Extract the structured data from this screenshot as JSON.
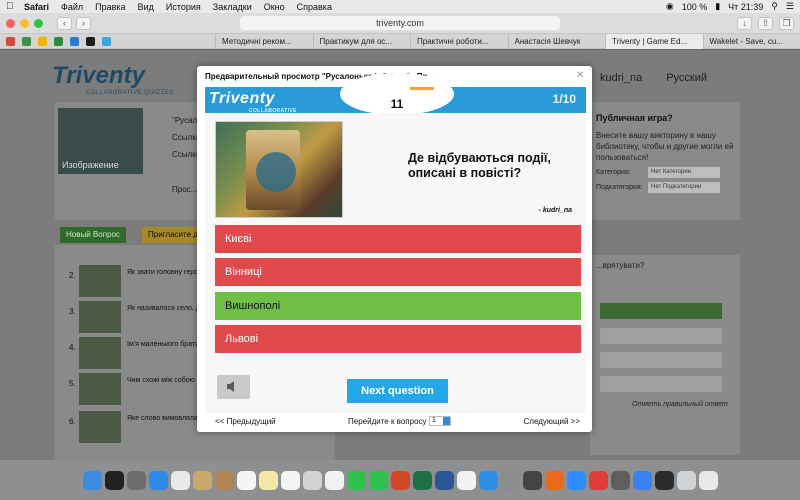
{
  "menubar": {
    "app": "Safari",
    "items": [
      "Файл",
      "Правка",
      "Вид",
      "История",
      "Закладки",
      "Окно",
      "Справка"
    ],
    "battery": "100 %",
    "clock": "Чт 21:39"
  },
  "toolbar": {
    "url": "triventy.com"
  },
  "tabs": [
    "Методичні реком...",
    "Практикум для ос...",
    "Практичні роботи...",
    "Анастасія Шевчук",
    "Triventy | Game Ed...",
    "Wakelet - Save, cu..."
  ],
  "page": {
    "logo": "Triventy",
    "logo_tagline": "COLLABORATIVE QUIZZES",
    "user": "kudri_na",
    "language": "Русский",
    "quiz_name_partial": "\"Русалонь...",
    "link_label_1": "Ссылка в...",
    "link_label_2": "Ссылка в...",
    "image_label": "Изображение",
    "preview_partial": "Прос...",
    "public_title": "Публичная игра?",
    "public_text": "Внесите вашу викторину в нашу библиотеку, чтобы и другие могли ей пользоваться!",
    "category_label": "Категория:",
    "category_value": "Нет Категории",
    "subcategory_label": "Подкатегория:",
    "subcategory_value": "Нет Подкатегории",
    "new_question_btn": "Новый Вопрос",
    "invite_btn": "Пригласите д...",
    "right_hint": "...врятувати?",
    "mark_correct": "Отметь правильный ответ",
    "list": [
      {
        "num": "2.",
        "q": "Як звати головну герої..."
      },
      {
        "num": "3.",
        "q": "Як називалося село, д... Софійки?"
      },
      {
        "num": "4.",
        "q": "Ім'я маленького брати..."
      },
      {
        "num": "5.",
        "q": "Чим схожі між собою б..."
      },
      {
        "num": "6.",
        "q": "Яке слово вимовляла ... потрапити у минуле?"
      }
    ]
  },
  "modal": {
    "title": "Предварительный просмотр \"Русалонька із 7-В, або Пр...",
    "logo": "Triventy",
    "logo_tagline": "COLLABORATIVE QUIZZES",
    "timer": "11",
    "timer_remaining_fraction": 0.6,
    "progress": "1/10",
    "question": "Де відбуваються події, описані в повісті?",
    "author": "- kudri_na",
    "answers": [
      {
        "label": "Києві",
        "correct": false
      },
      {
        "label": "Вінниці",
        "correct": false
      },
      {
        "label": "Вишнополі",
        "correct": true
      },
      {
        "label": "Львові",
        "correct": false
      }
    ],
    "next_button": "Next question",
    "footer": {
      "prev": "<< Предыдущий",
      "goto": "Перейдите к вопросу",
      "goto_value": "1",
      "next": "Следующий >>"
    }
  },
  "colors": {
    "header_blue": "#2a9bd6",
    "answer_red": "#e14a4d",
    "answer_green": "#6fbe47",
    "next_blue": "#22a8e8",
    "timer_orange": "#f6a623"
  }
}
